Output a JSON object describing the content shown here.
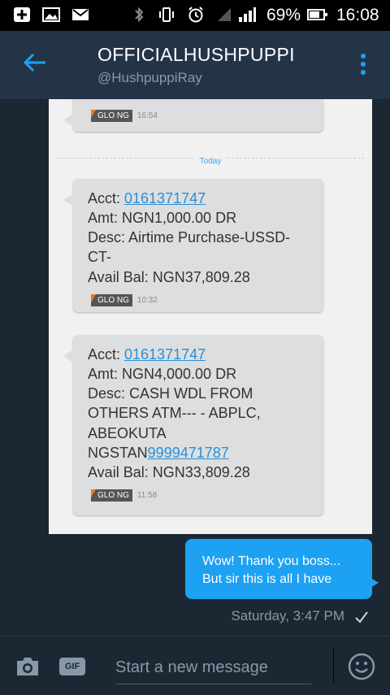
{
  "status_bar": {
    "icons": [
      "plus-box-icon",
      "image-icon",
      "mail-icon",
      "bluetooth-icon",
      "vibrate-icon",
      "alarm-icon",
      "signal-icon"
    ],
    "battery_percent": "69%",
    "time": "16:08"
  },
  "header": {
    "name": "OFFICIALHUSHPUPPI",
    "handle": "@HushpuppiRay"
  },
  "screenshot": {
    "top_tag": "GLO NG",
    "top_time": "16:54",
    "day_label": "Today",
    "sms": [
      {
        "acct_label": "Acct: ",
        "acct_number": "0161371747",
        "amt": "Amt: NGN1,000.00 DR",
        "desc_line1": "Desc: Airtime Purchase-USSD-",
        "desc_line2": "CT-",
        "bal": "Avail Bal: NGN37,809.28",
        "tag": "GLO NG",
        "time": "10:32"
      },
      {
        "acct_label": "Acct: ",
        "acct_number": "0161371747",
        "amt": "Amt: NGN4,000.00 DR",
        "desc_line1": "Desc: CASH WDL FROM",
        "desc_line2": "OTHERS ATM--- - ABPLC,",
        "desc_line3": "ABEOKUTA",
        "ngstan_prefix": "NGSTAN",
        "ngstan_number": "9999471787",
        "bal": "Avail Bal: NGN33,809.28",
        "tag": "GLO NG",
        "time": "11:58"
      }
    ]
  },
  "my_message": {
    "line1": "Wow! Thank you boss...",
    "line2": "But sir this is all I have",
    "timestamp": "Saturday, 3:47 PM"
  },
  "composer": {
    "gif_label": "GIF",
    "placeholder": "Start a new message"
  },
  "colors": {
    "accent": "#1da1f2",
    "app_bar": "#243447",
    "background": "#1b2733"
  }
}
